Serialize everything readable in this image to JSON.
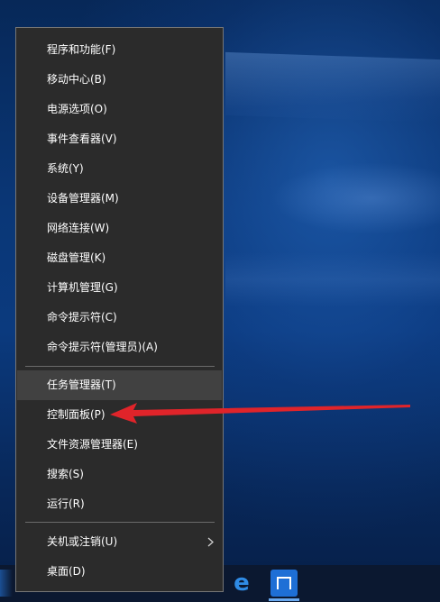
{
  "menu": {
    "group1": [
      {
        "label": "程序和功能(F)"
      },
      {
        "label": "移动中心(B)"
      },
      {
        "label": "电源选项(O)"
      },
      {
        "label": "事件查看器(V)"
      },
      {
        "label": "系统(Y)"
      },
      {
        "label": "设备管理器(M)"
      },
      {
        "label": "网络连接(W)"
      },
      {
        "label": "磁盘管理(K)"
      },
      {
        "label": "计算机管理(G)"
      },
      {
        "label": "命令提示符(C)"
      },
      {
        "label": "命令提示符(管理员)(A)"
      }
    ],
    "group2": [
      {
        "label": "任务管理器(T)"
      },
      {
        "label": "控制面板(P)"
      },
      {
        "label": "文件资源管理器(E)"
      },
      {
        "label": "搜索(S)"
      },
      {
        "label": "运行(R)"
      }
    ],
    "group3": [
      {
        "label": "关机或注销(U)"
      },
      {
        "label": "桌面(D)"
      }
    ],
    "highlighted_item": "任务管理器(T)",
    "annotated_item": "控制面板(P)"
  },
  "annotation": {
    "color": "#e0242a",
    "icon": "red-arrow-icon"
  },
  "taskbar": {
    "icons": [
      "edge-browser-icon",
      "maxthon-browser-icon"
    ]
  },
  "colors": {
    "menu_bg": "#2b2b2b",
    "highlight": "#414141",
    "accent": "#1e6fd6"
  }
}
